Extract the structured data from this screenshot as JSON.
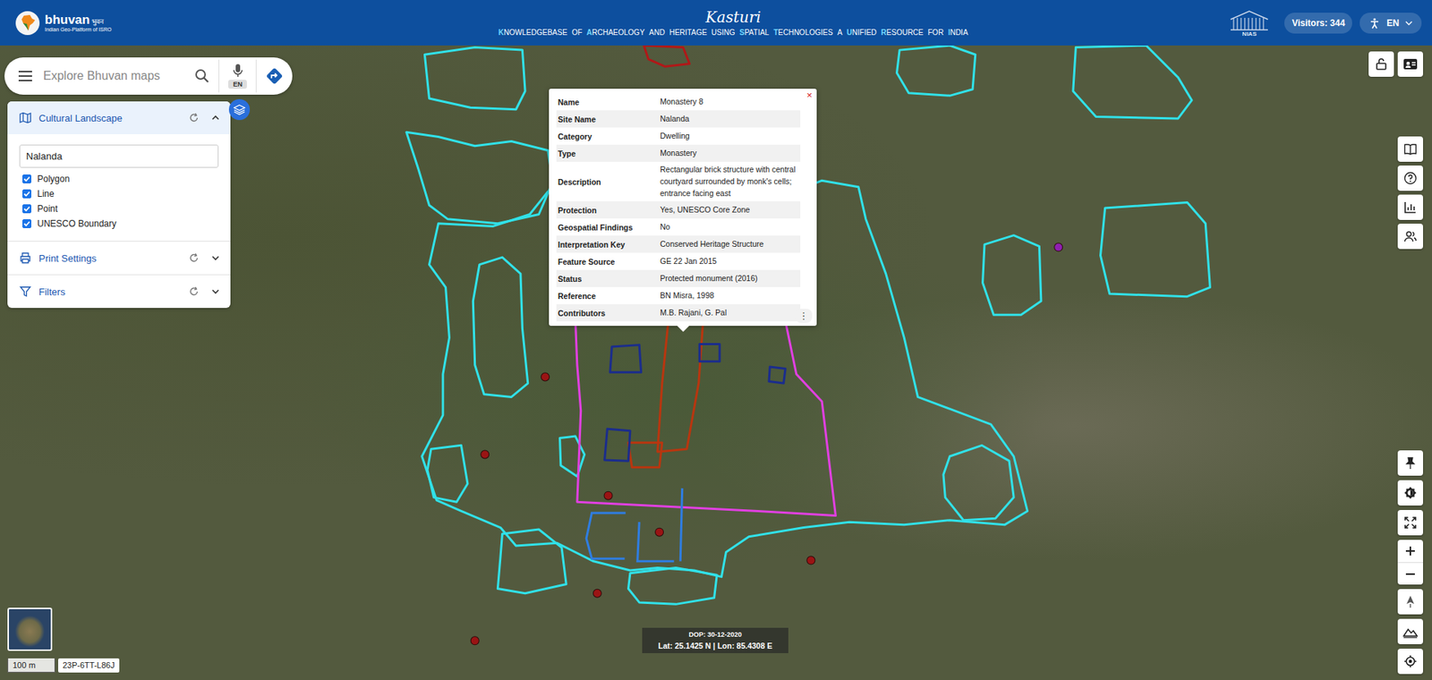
{
  "header": {
    "logo_name": "bhuvan",
    "logo_hindi": "भुवन",
    "logo_tagline": "Indian Geo-Platform of ISRO",
    "title": "Kasturi",
    "subtitle_words": [
      {
        "text": "KNOWLEDGEBASE",
        "accent": true
      },
      {
        "text": "OF",
        "accent": false
      },
      {
        "text": "ARCHAEOLOGY",
        "accent": true
      },
      {
        "text": "AND",
        "accent": false
      },
      {
        "text": "HERITAGE",
        "accent": false
      },
      {
        "text": "USING",
        "accent": false
      },
      {
        "text": "SPATIAL",
        "accent": true
      },
      {
        "text": "TECHNOLOGIES",
        "accent": true
      },
      {
        "text": "A",
        "accent": false
      },
      {
        "text": "UNIFIED",
        "accent": true
      },
      {
        "text": "RESOURCE",
        "accent": true
      },
      {
        "text": "FOR",
        "accent": false
      },
      {
        "text": "INDIA",
        "accent": true
      }
    ],
    "partner": "NIAS",
    "visitors": "Visitors: 344",
    "language": "EN"
  },
  "search": {
    "placeholder": "Explore Bhuvan maps",
    "mic_badge": "EN"
  },
  "panel": {
    "sections": [
      {
        "title": "Cultural Landscape",
        "expanded": true
      },
      {
        "title": "Print Settings",
        "expanded": false
      },
      {
        "title": "Filters",
        "expanded": false
      }
    ],
    "query": "Nalanda",
    "layers": [
      {
        "label": "Polygon",
        "checked": true
      },
      {
        "label": "Line",
        "checked": true
      },
      {
        "label": "Point",
        "checked": true
      },
      {
        "label": "UNESCO Boundary",
        "checked": true
      }
    ]
  },
  "popup": {
    "close": "×",
    "more": "⋮",
    "rows": [
      {
        "label": "Name",
        "value": "Monastery 8"
      },
      {
        "label": "Site Name",
        "value": "Nalanda"
      },
      {
        "label": "Category",
        "value": "Dwelling"
      },
      {
        "label": "Type",
        "value": "Monastery"
      },
      {
        "label": "Description",
        "value": "Rectangular brick structure with central courtyard surrounded by monk's cells; entrance facing east"
      },
      {
        "label": "Protection",
        "value": "Yes, UNESCO Core Zone"
      },
      {
        "label": "Geospatial Findings",
        "value": "No"
      },
      {
        "label": "Interpretation Key",
        "value": "Conserved Heritage Structure"
      },
      {
        "label": "Feature Source",
        "value": "GE 22 Jan 2015"
      },
      {
        "label": "Status",
        "value": "Protected monument (2016)"
      },
      {
        "label": "Reference",
        "value": "BN Misra, 1998"
      },
      {
        "label": "Contributors",
        "value": "M.B. Rajani, G. Pal"
      }
    ]
  },
  "map": {
    "features": [
      {
        "kind": "polygon",
        "color": "#31e1e8"
      },
      {
        "kind": "polygon",
        "color": "#31e1e8"
      },
      {
        "kind": "polygon",
        "color": "#31e1e8"
      },
      {
        "kind": "polygon",
        "color": "#31e1e8"
      },
      {
        "kind": "polygon",
        "color": "#31e1e8"
      },
      {
        "kind": "polygon",
        "color": "#31e1e8"
      },
      {
        "kind": "polygon",
        "color": "#31e1e8"
      },
      {
        "kind": "polygon",
        "color": "#31e1e8"
      },
      {
        "kind": "polygon",
        "color": "#31e1e8"
      },
      {
        "kind": "polygon",
        "color": "#31e1e8"
      },
      {
        "kind": "polygon",
        "color": "#31e1e8"
      },
      {
        "kind": "polygon",
        "color": "#31e1e8"
      },
      {
        "kind": "polygon",
        "color": "#31e1e8"
      },
      {
        "kind": "polygon",
        "color": "#e040e0"
      },
      {
        "kind": "polygon",
        "color": "#b8360f"
      },
      {
        "kind": "polygon",
        "color": "#b8360f"
      },
      {
        "kind": "polygon",
        "color": "#b01818"
      },
      {
        "kind": "polygon",
        "color": "#1b2d8c"
      },
      {
        "kind": "polygon",
        "color": "#1b2d8c"
      },
      {
        "kind": "polygon",
        "color": "#1b2d8c"
      },
      {
        "kind": "polygon",
        "color": "#1b2d8c"
      },
      {
        "kind": "line",
        "color": "#2f7de0"
      },
      {
        "kind": "line",
        "color": "#2f7de0"
      },
      {
        "kind": "line",
        "color": "#2f7de0"
      },
      {
        "kind": "point",
        "color": "#9a1414"
      },
      {
        "kind": "point",
        "color": "#9a1414"
      },
      {
        "kind": "point",
        "color": "#9a1414"
      },
      {
        "kind": "point",
        "color": "#9a1414"
      },
      {
        "kind": "point",
        "color": "#9a1414"
      },
      {
        "kind": "point",
        "color": "#9a1414"
      },
      {
        "kind": "point",
        "color": "#9a1414"
      },
      {
        "kind": "point",
        "color": "#8f1fb0"
      }
    ]
  },
  "footer": {
    "scale": "100 m",
    "plus_code": "23P-6TT-L86J",
    "dop": "DOP: 30-12-2020",
    "coords": "Lat: 25.1425 N | Lon: 85.4308 E"
  }
}
